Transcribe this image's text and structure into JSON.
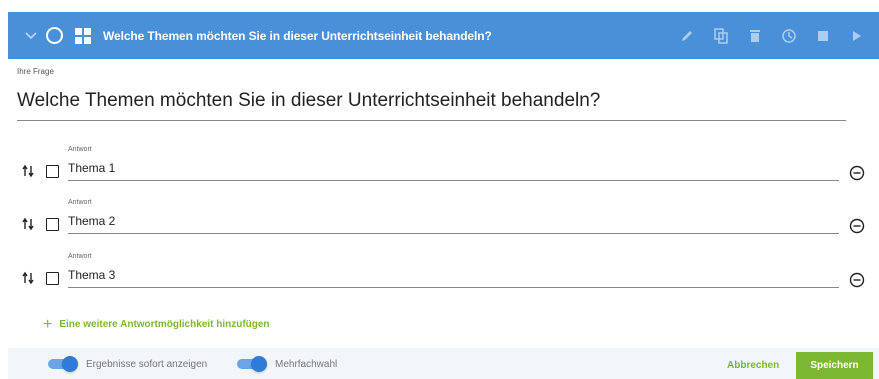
{
  "header": {
    "title": "Welche Themen möchten Sie in dieser Unterrichtseinheit behandeln?",
    "tools": [
      "pencil-icon",
      "copy-icon",
      "trash-icon",
      "history-icon",
      "stop-icon",
      "play-icon"
    ]
  },
  "question": {
    "label": "Ihre Frage",
    "text": "Welche Themen möchten Sie in dieser Unterrichtseinheit behandeln?"
  },
  "answers": [
    {
      "label": "Antwort",
      "value": "Thema 1",
      "checked": false
    },
    {
      "label": "Antwort",
      "value": "Thema 2",
      "checked": false
    },
    {
      "label": "Antwort",
      "value": "Thema 3",
      "checked": false
    }
  ],
  "add_answer_label": "Eine weitere Antwortmöglichkeit hinzufügen",
  "footer": {
    "toggle_results_label": "Ergebnisse sofort anzeigen",
    "toggle_results_on": true,
    "toggle_multi_label": "Mehrfachwahl",
    "toggle_multi_on": true,
    "cancel_label": "Abbrechen",
    "save_label": "Speichern"
  },
  "colors": {
    "header_bg": "#4a90d9",
    "accent_green": "#7cb82f",
    "toggle_blue": "#2f7bd8",
    "footer_bg": "#f2f6fa"
  }
}
